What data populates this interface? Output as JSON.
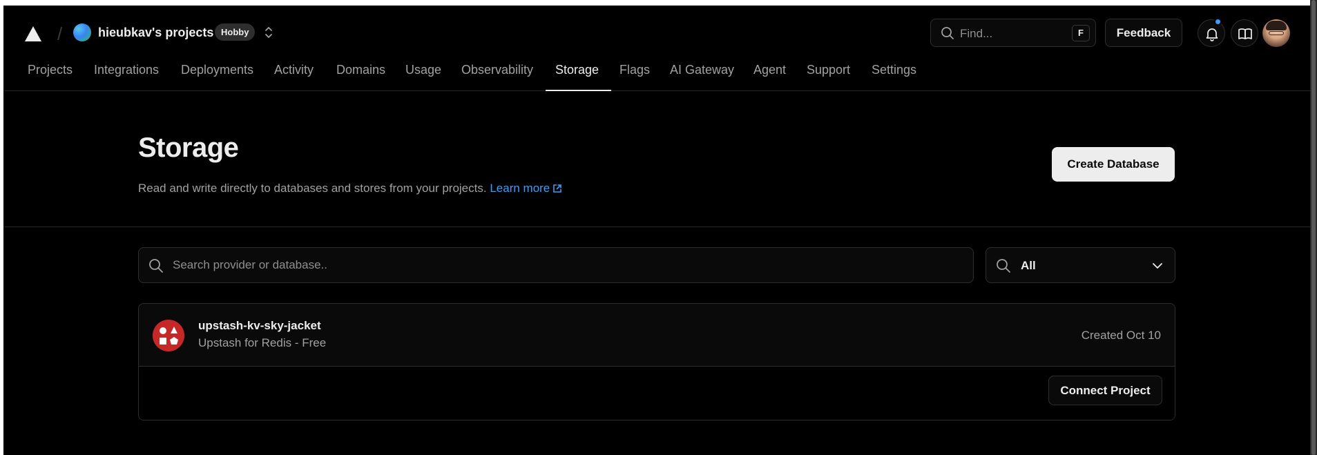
{
  "topbar": {
    "team_name": "hieubkav's projects",
    "plan_badge": "Hobby",
    "find_placeholder": "Find...",
    "find_shortcut": "F",
    "feedback_label": "Feedback"
  },
  "tabs": [
    {
      "label": "Projects"
    },
    {
      "label": "Integrations"
    },
    {
      "label": "Deployments"
    },
    {
      "label": "Activity"
    },
    {
      "label": "Domains"
    },
    {
      "label": "Usage"
    },
    {
      "label": "Observability"
    },
    {
      "label": "Storage"
    },
    {
      "label": "Flags"
    },
    {
      "label": "AI Gateway"
    },
    {
      "label": "Agent"
    },
    {
      "label": "Support"
    },
    {
      "label": "Settings"
    }
  ],
  "active_tab": "Storage",
  "page": {
    "title": "Storage",
    "description": "Read and write directly to databases and stores from your projects.",
    "learn_more": "Learn more",
    "create_button": "Create Database"
  },
  "filters": {
    "search_placeholder": "Search provider or database..",
    "type_value": "All"
  },
  "databases": [
    {
      "name": "upstash-kv-sky-jacket",
      "provider": "Upstash for Redis - Free",
      "created": "Created Oct 10",
      "connect_label": "Connect Project"
    }
  ],
  "colors": {
    "background": "#000000",
    "link": "#3b9eff",
    "notification_dot": "#3b9eff",
    "db_icon": "#c62828"
  },
  "icons": [
    "vercel-logo",
    "chevrons-updown-icon",
    "search-icon",
    "bell-icon",
    "book-icon",
    "external-link-icon",
    "chevron-down-icon",
    "upstash-icon"
  ]
}
